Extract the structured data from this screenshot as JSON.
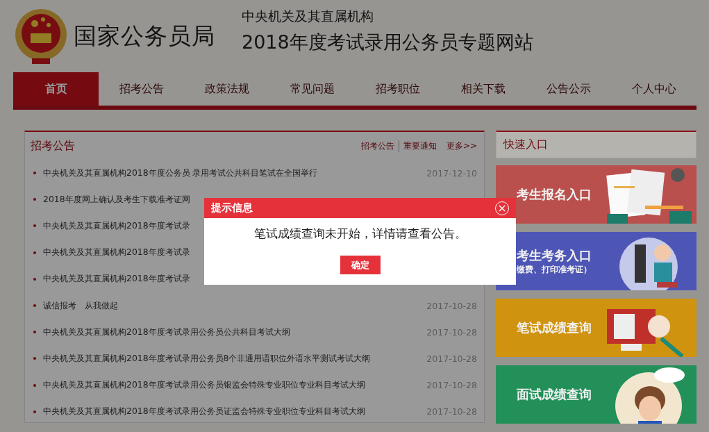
{
  "header": {
    "org_name": "国家公务员局",
    "subtitle": "中央机关及其直属机构",
    "site_title": "2018年度考试录用公务员专题网站"
  },
  "nav": [
    {
      "label": "首页",
      "selected": true
    },
    {
      "label": "招考公告",
      "selected": false
    },
    {
      "label": "政策法规",
      "selected": false
    },
    {
      "label": "常见问题",
      "selected": false
    },
    {
      "label": "招考职位",
      "selected": false
    },
    {
      "label": "相关下载",
      "selected": false
    },
    {
      "label": "公告公示",
      "selected": false
    },
    {
      "label": "个人中心",
      "selected": false
    }
  ],
  "announcements": {
    "title": "招考公告",
    "links": [
      "招考公告",
      "重要通知",
      "更多>>"
    ],
    "items": [
      {
        "title": "中央机关及其直属机构2018年度公务员 录用考试公共科目笔试在全国举行",
        "date": "2017-12-10"
      },
      {
        "title": "2018年度网上确认及考生下载准考证网"
      },
      {
        "title": "中央机关及其直属机构2018年度考试录"
      },
      {
        "title": "中央机关及其直属机构2018年度考试录"
      },
      {
        "title": "中央机关及其直属机构2018年度考试录"
      },
      {
        "title": "诚信报考　从我做起",
        "date": "2017-10-28"
      },
      {
        "title": "中央机关及其直属机构2018年度考试录用公务员公共科目考试大纲",
        "date": "2017-10-28"
      },
      {
        "title": "中央机关及其直属机构2018年度考试录用公务员8个非通用语职位外语水平测试考试大纲",
        "date": "2017-10-28"
      },
      {
        "title": "中央机关及其直属机构2018年度考试录用公务员银监会特殊专业职位专业科目考试大纲",
        "date": "2017-10-28"
      },
      {
        "title": "中央机关及其直属机构2018年度考试录用公务员证监会特殊专业职位专业科目考试大纲",
        "date": "2017-10-28"
      }
    ]
  },
  "quick_entry": {
    "title": "快速入口",
    "cards": [
      {
        "label": "考生报名入口",
        "color": "#b9504e"
      },
      {
        "label": "考生考务入口",
        "sublabel": "缴费、打印准考证）",
        "color": "#4e56b5"
      },
      {
        "label": "笔试成绩查询",
        "color": "#d0930f"
      },
      {
        "label": "面试成绩查询",
        "color": "#23905a"
      }
    ]
  },
  "dialog": {
    "title": "提示信息",
    "message": "笔试成绩查询未开始，详情请查看公告。",
    "button": "确定"
  }
}
